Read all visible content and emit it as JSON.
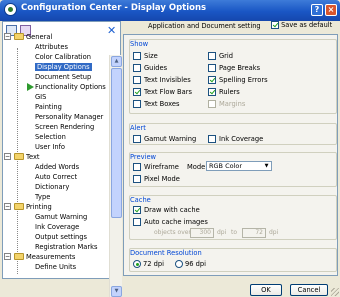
{
  "window": {
    "title": "Configuration Center - Display Options",
    "help_glyph": "?",
    "close_glyph": "×"
  },
  "left_panel": {
    "delete_glyph": "✕",
    "tree": [
      {
        "label": "General",
        "type": "folder",
        "expanded": true
      },
      {
        "label": "Attributes",
        "type": "item"
      },
      {
        "label": "Color Calibration",
        "type": "item"
      },
      {
        "label": "Display Options",
        "type": "item",
        "selected": true
      },
      {
        "label": "Document Setup",
        "type": "item"
      },
      {
        "label": "Functionality Options",
        "type": "item"
      },
      {
        "label": "GIS",
        "type": "item"
      },
      {
        "label": "Painting",
        "type": "item"
      },
      {
        "label": "Personality Manager",
        "type": "item"
      },
      {
        "label": "Screen Rendering",
        "type": "item"
      },
      {
        "label": "Selection",
        "type": "item"
      },
      {
        "label": "User Info",
        "type": "item"
      },
      {
        "label": "Text",
        "type": "folder",
        "expanded": true
      },
      {
        "label": "Added Words",
        "type": "item"
      },
      {
        "label": "Auto Correct",
        "type": "item"
      },
      {
        "label": "Dictionary",
        "type": "item"
      },
      {
        "label": "Type",
        "type": "item"
      },
      {
        "label": "Printing",
        "type": "folder",
        "expanded": true
      },
      {
        "label": "Gamut Warning",
        "type": "item"
      },
      {
        "label": "Ink Coverage",
        "type": "item"
      },
      {
        "label": "Output settings",
        "type": "item"
      },
      {
        "label": "Registration Marks",
        "type": "item"
      },
      {
        "label": "Measurements",
        "type": "folder",
        "expanded": true
      },
      {
        "label": "Define Units",
        "type": "item"
      }
    ],
    "expander_minus": "−"
  },
  "right_panel": {
    "header": "Application and Document setting",
    "save_as_default": {
      "label": "Save as default",
      "checked": true
    },
    "show": {
      "title": "Show",
      "left": [
        {
          "label": "Size",
          "checked": false
        },
        {
          "label": "Guides",
          "checked": false
        },
        {
          "label": "Text Invisibles",
          "checked": false
        },
        {
          "label": "Text Flow Bars",
          "checked": true
        },
        {
          "label": "Text Boxes",
          "checked": false
        }
      ],
      "right": [
        {
          "label": "Grid",
          "checked": false
        },
        {
          "label": "Page Breaks",
          "checked": false
        },
        {
          "label": "Spelling Errors",
          "checked": true
        },
        {
          "label": "Rulers",
          "checked": true
        },
        {
          "label": "Margins",
          "checked": false,
          "disabled": true
        }
      ]
    },
    "alert": {
      "title": "Alert",
      "gamut_warning": {
        "label": "Gamut Warning",
        "checked": false
      },
      "ink_coverage": {
        "label": "Ink Coverage",
        "checked": false
      }
    },
    "preview": {
      "title": "Preview",
      "wireframe": {
        "label": "Wireframe",
        "checked": false
      },
      "pixel_mode": {
        "label": "Pixel Mode",
        "checked": false
      },
      "mode_label": "Mode:",
      "mode_value": "RGB Color",
      "dropdown_glyph": "▼"
    },
    "cache": {
      "title": "Cache",
      "draw_with_cache": {
        "label": "Draw with cache",
        "checked": true
      },
      "auto_cache_images": {
        "label": "Auto cache images",
        "checked": false
      },
      "objects_over_label": "objects over",
      "objects_over_value": "300",
      "dpi_label": "dpi",
      "to_label": "to",
      "to_value": "72",
      "dpi_label2": "dpi"
    },
    "resolution": {
      "title": "Document Resolution",
      "options": [
        {
          "label": "72 dpi",
          "selected": true
        },
        {
          "label": "96 dpi",
          "selected": false
        }
      ]
    }
  },
  "buttons": {
    "ok": "OK",
    "cancel": "Cancel"
  },
  "colors": {
    "title_bar": "#1a56c4",
    "selection": "#316ac5",
    "group_title": "#0046d5",
    "check": "#21a121"
  }
}
